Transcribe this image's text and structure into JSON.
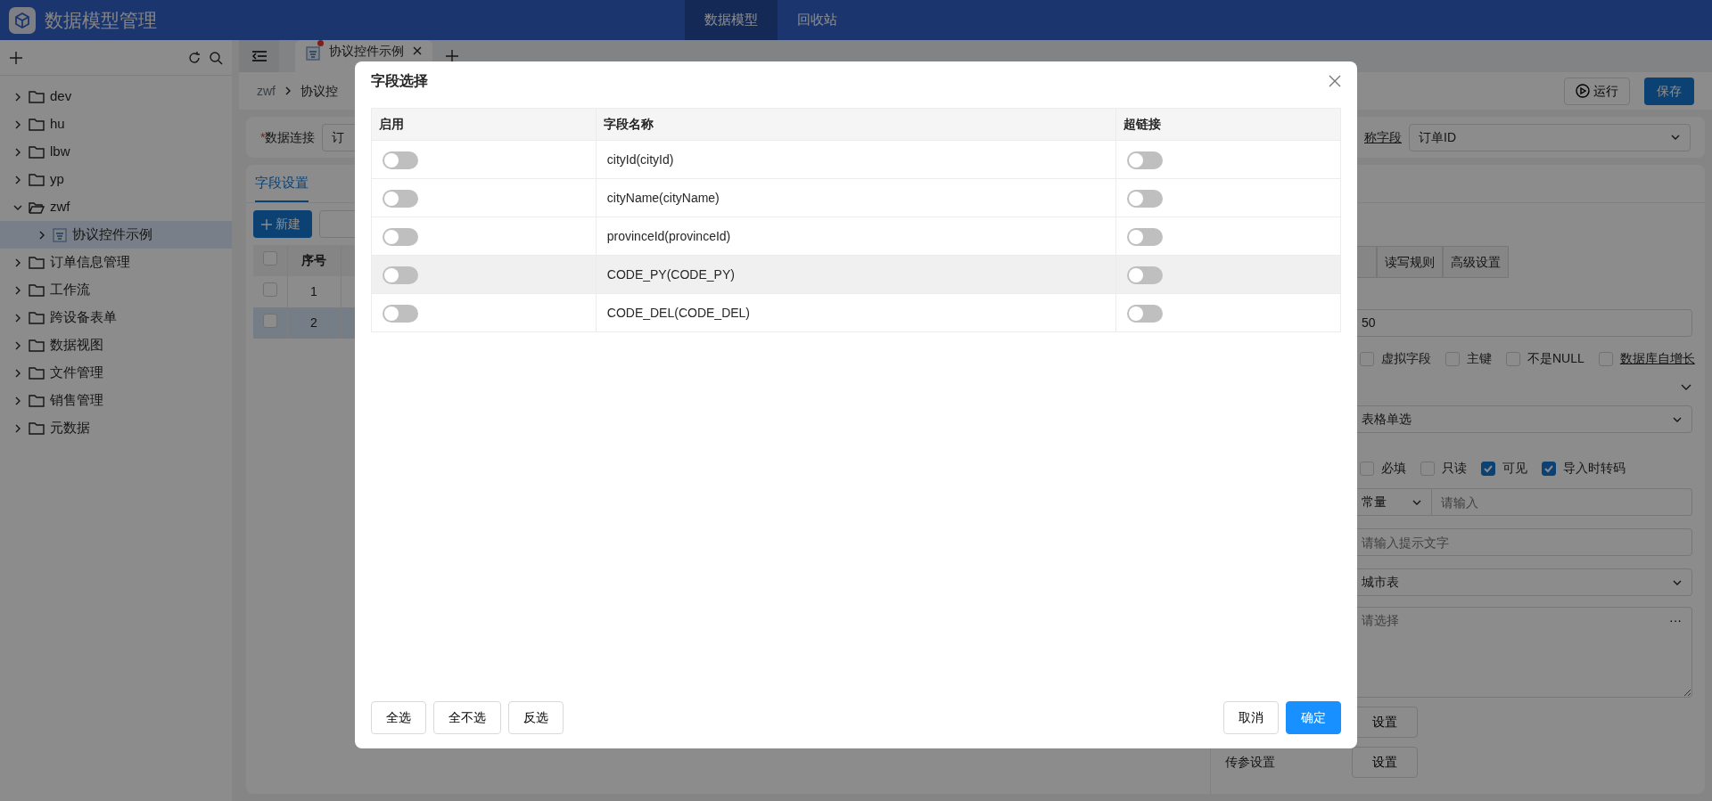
{
  "header": {
    "title": "数据模型管理",
    "nav": [
      {
        "label": "数据模型",
        "selected": true
      },
      {
        "label": "回收站",
        "selected": false
      }
    ]
  },
  "sidebar": {
    "tree": [
      {
        "label": "dev",
        "kind": "folder",
        "expanded": false,
        "selected": false
      },
      {
        "label": "hu",
        "kind": "folder",
        "expanded": false,
        "selected": false
      },
      {
        "label": "lbw",
        "kind": "folder",
        "expanded": false,
        "selected": false
      },
      {
        "label": "yp",
        "kind": "folder",
        "expanded": false,
        "selected": false
      },
      {
        "label": "zwf",
        "kind": "folder",
        "expanded": true,
        "selected": false,
        "children": [
          {
            "label": "协议控件示例",
            "kind": "model",
            "expanded": false,
            "selected": true
          }
        ]
      },
      {
        "label": "订单信息管理",
        "kind": "folder",
        "expanded": false,
        "selected": false
      },
      {
        "label": "工作流",
        "kind": "folder",
        "expanded": false,
        "selected": false
      },
      {
        "label": "跨设备表单",
        "kind": "folder",
        "expanded": false,
        "selected": false
      },
      {
        "label": "数据视图",
        "kind": "folder",
        "expanded": false,
        "selected": false
      },
      {
        "label": "文件管理",
        "kind": "folder",
        "expanded": false,
        "selected": false
      },
      {
        "label": "销售管理",
        "kind": "folder",
        "expanded": false,
        "selected": false
      },
      {
        "label": "元数据",
        "kind": "folder",
        "expanded": false,
        "selected": false
      }
    ]
  },
  "tabs": [
    {
      "label": "协议控件示例",
      "unsaved": true
    }
  ],
  "breadcrumb": [
    "zwf",
    "协议控"
  ],
  "toolbar": {
    "run": "运行",
    "save": "保存"
  },
  "form": {
    "required_mark": "*",
    "connection_label": "数据连接",
    "connection_value": "订",
    "name_field_label": "称字段",
    "name_field_value": "订单ID"
  },
  "field_tabs": [
    {
      "label": "字段设置",
      "selected": true
    }
  ],
  "table_buttons": {
    "new": "新建"
  },
  "table": {
    "all_checked": false,
    "columns": [
      "序号"
    ],
    "rows": [
      {
        "index": "1",
        "checked": false,
        "selected": false
      },
      {
        "index": "2",
        "checked": false,
        "selected": true
      }
    ]
  },
  "properties": {
    "tabs": [
      {
        "label": "读写规则",
        "selected": false
      },
      {
        "label": "高级设置",
        "selected": false
      }
    ],
    "length_value": "50",
    "flags": [
      {
        "label": "虚拟字段",
        "checked": false,
        "link": false
      },
      {
        "label": "主键",
        "checked": false,
        "link": false
      },
      {
        "label": "不是NULL",
        "checked": false,
        "link": false
      },
      {
        "label": "数据库自增长",
        "checked": false,
        "link": true
      }
    ],
    "control_value": "表格单选",
    "options": [
      {
        "label": "必填",
        "checked": false
      },
      {
        "label": "只读",
        "checked": false
      },
      {
        "label": "可见",
        "checked": true
      },
      {
        "label": "导入时转码",
        "checked": true
      }
    ],
    "default_type": "常量",
    "default_placeholder": "请输入",
    "hint_placeholder": "请输入提示文字",
    "source_value": "城市表",
    "filter_placeholder": "请选择",
    "more": "···",
    "settings_button": "设置",
    "param_label": "传参设置",
    "param_button": "设置"
  },
  "modal": {
    "title": "字段选择",
    "columns": [
      "启用",
      "字段名称",
      "超链接"
    ],
    "rows": [
      {
        "enabled": false,
        "name": "cityId(cityId)",
        "hyperlink": false,
        "highlighted": false
      },
      {
        "enabled": false,
        "name": "cityName(cityName)",
        "hyperlink": false,
        "highlighted": false
      },
      {
        "enabled": false,
        "name": "provinceId(provinceId)",
        "hyperlink": false,
        "highlighted": false
      },
      {
        "enabled": false,
        "name": "CODE_PY(CODE_PY)",
        "hyperlink": false,
        "highlighted": true
      },
      {
        "enabled": false,
        "name": "CODE_DEL(CODE_DEL)",
        "hyperlink": false,
        "highlighted": false
      }
    ],
    "left_buttons": [
      "全选",
      "全不选",
      "反选"
    ],
    "cancel": "取消",
    "ok": "确定"
  }
}
